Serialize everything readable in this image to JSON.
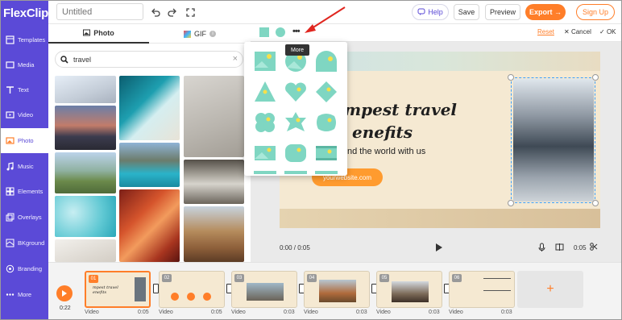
{
  "app": {
    "name": "FlexClip",
    "title_placeholder": "Untitled"
  },
  "topbar": {
    "help": "Help",
    "save": "Save",
    "preview": "Preview",
    "export": "Export →",
    "signup": "Sign Up"
  },
  "sidebar": {
    "items": [
      {
        "label": "Templates",
        "icon": "templates-icon"
      },
      {
        "label": "Media",
        "icon": "media-icon"
      },
      {
        "label": "Text",
        "icon": "text-icon"
      },
      {
        "label": "Video",
        "icon": "video-icon"
      },
      {
        "label": "Photo",
        "icon": "photo-icon",
        "active": true
      },
      {
        "label": "Music",
        "icon": "music-icon"
      },
      {
        "label": "Elements",
        "icon": "elements-icon"
      },
      {
        "label": "Overlays",
        "icon": "overlays-icon"
      },
      {
        "label": "BKground",
        "icon": "background-icon"
      },
      {
        "label": "Branding",
        "icon": "branding-icon"
      },
      {
        "label": "More",
        "icon": "more-icon"
      }
    ]
  },
  "panel": {
    "tab_photo": "Photo",
    "tab_gif": "GIF",
    "search_value": "travel"
  },
  "editor": {
    "reset": "Reset",
    "cancel": "Cancel",
    "ok": "OK",
    "tooltip": "More"
  },
  "slide": {
    "title_line1": "mpest travel",
    "title_line2": "enefits",
    "subtitle": "around the world with us",
    "button": "yourwebsite.com"
  },
  "playback": {
    "current": "0:00",
    "total": "0:05",
    "duration": "0:05"
  },
  "timeline": {
    "time": "0:22",
    "clips": [
      {
        "num": "01",
        "label": "Video",
        "dur": "0:05"
      },
      {
        "num": "02",
        "label": "Video",
        "dur": "0:05"
      },
      {
        "num": "03",
        "label": "Video",
        "dur": "0:03"
      },
      {
        "num": "04",
        "label": "Video",
        "dur": "0:03"
      },
      {
        "num": "05",
        "label": "Video",
        "dur": "0:03"
      },
      {
        "num": "06",
        "label": "Video",
        "dur": "0:03"
      }
    ],
    "add": "+"
  },
  "colors": {
    "brand": "#5b4ad7",
    "accent": "#ff7e29",
    "mask": "#7fd6c2"
  }
}
